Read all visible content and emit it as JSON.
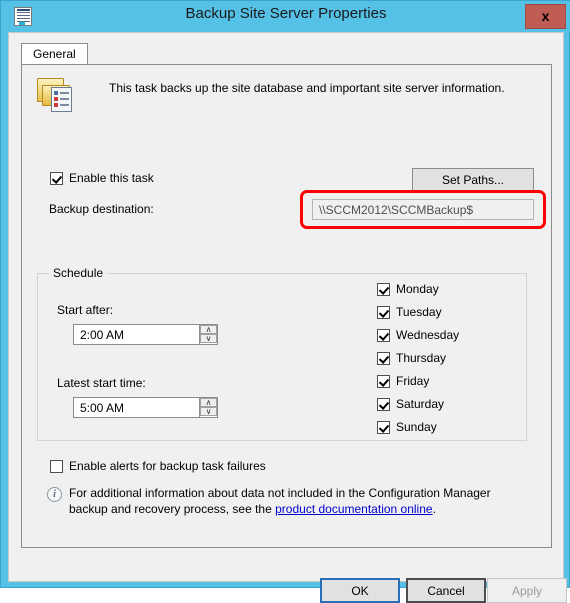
{
  "window": {
    "title": "Backup Site Server Properties",
    "icon": "properties-page-icon",
    "close_label": "x",
    "frame_color": "#55c1e7",
    "close_button_color": "#bf5c53"
  },
  "tabs": [
    {
      "label": "General",
      "selected": true
    }
  ],
  "header": {
    "icon": "backup-folder-checklist-icon",
    "description": "This task backs up the site database and important site server information."
  },
  "enable_task": {
    "label": "Enable this task",
    "checked": true
  },
  "set_paths_button": {
    "label": "Set Paths..."
  },
  "backup_destination": {
    "label": "Backup destination:",
    "value": "\\\\SCCM2012\\SCCMBackup$",
    "readonly": true,
    "highlight_color": "#ff0000"
  },
  "schedule": {
    "group_title": "Schedule",
    "start_after": {
      "label": "Start after:",
      "value": "2:00 AM",
      "spin_up": "∧",
      "spin_down": "∨"
    },
    "latest_start_time": {
      "label": "Latest start time:",
      "value": "5:00 AM",
      "spin_up": "∧",
      "spin_down": "∨"
    },
    "days": [
      {
        "label": "Monday",
        "checked": true
      },
      {
        "label": "Tuesday",
        "checked": true
      },
      {
        "label": "Wednesday",
        "checked": true
      },
      {
        "label": "Thursday",
        "checked": true
      },
      {
        "label": "Friday",
        "checked": true
      },
      {
        "label": "Saturday",
        "checked": true
      },
      {
        "label": "Sunday",
        "checked": true
      }
    ]
  },
  "enable_alerts": {
    "label": "Enable alerts for backup task failures",
    "checked": false
  },
  "info_note": {
    "icon": "info-icon",
    "glyph": "i",
    "text_before": "For additional information about data not included in the Configuration Manager backup and recovery process, see the ",
    "link_text": "product documentation online",
    "text_after": "."
  },
  "footer_buttons": {
    "ok": "OK",
    "cancel": "Cancel",
    "apply": "Apply",
    "apply_disabled": true
  }
}
